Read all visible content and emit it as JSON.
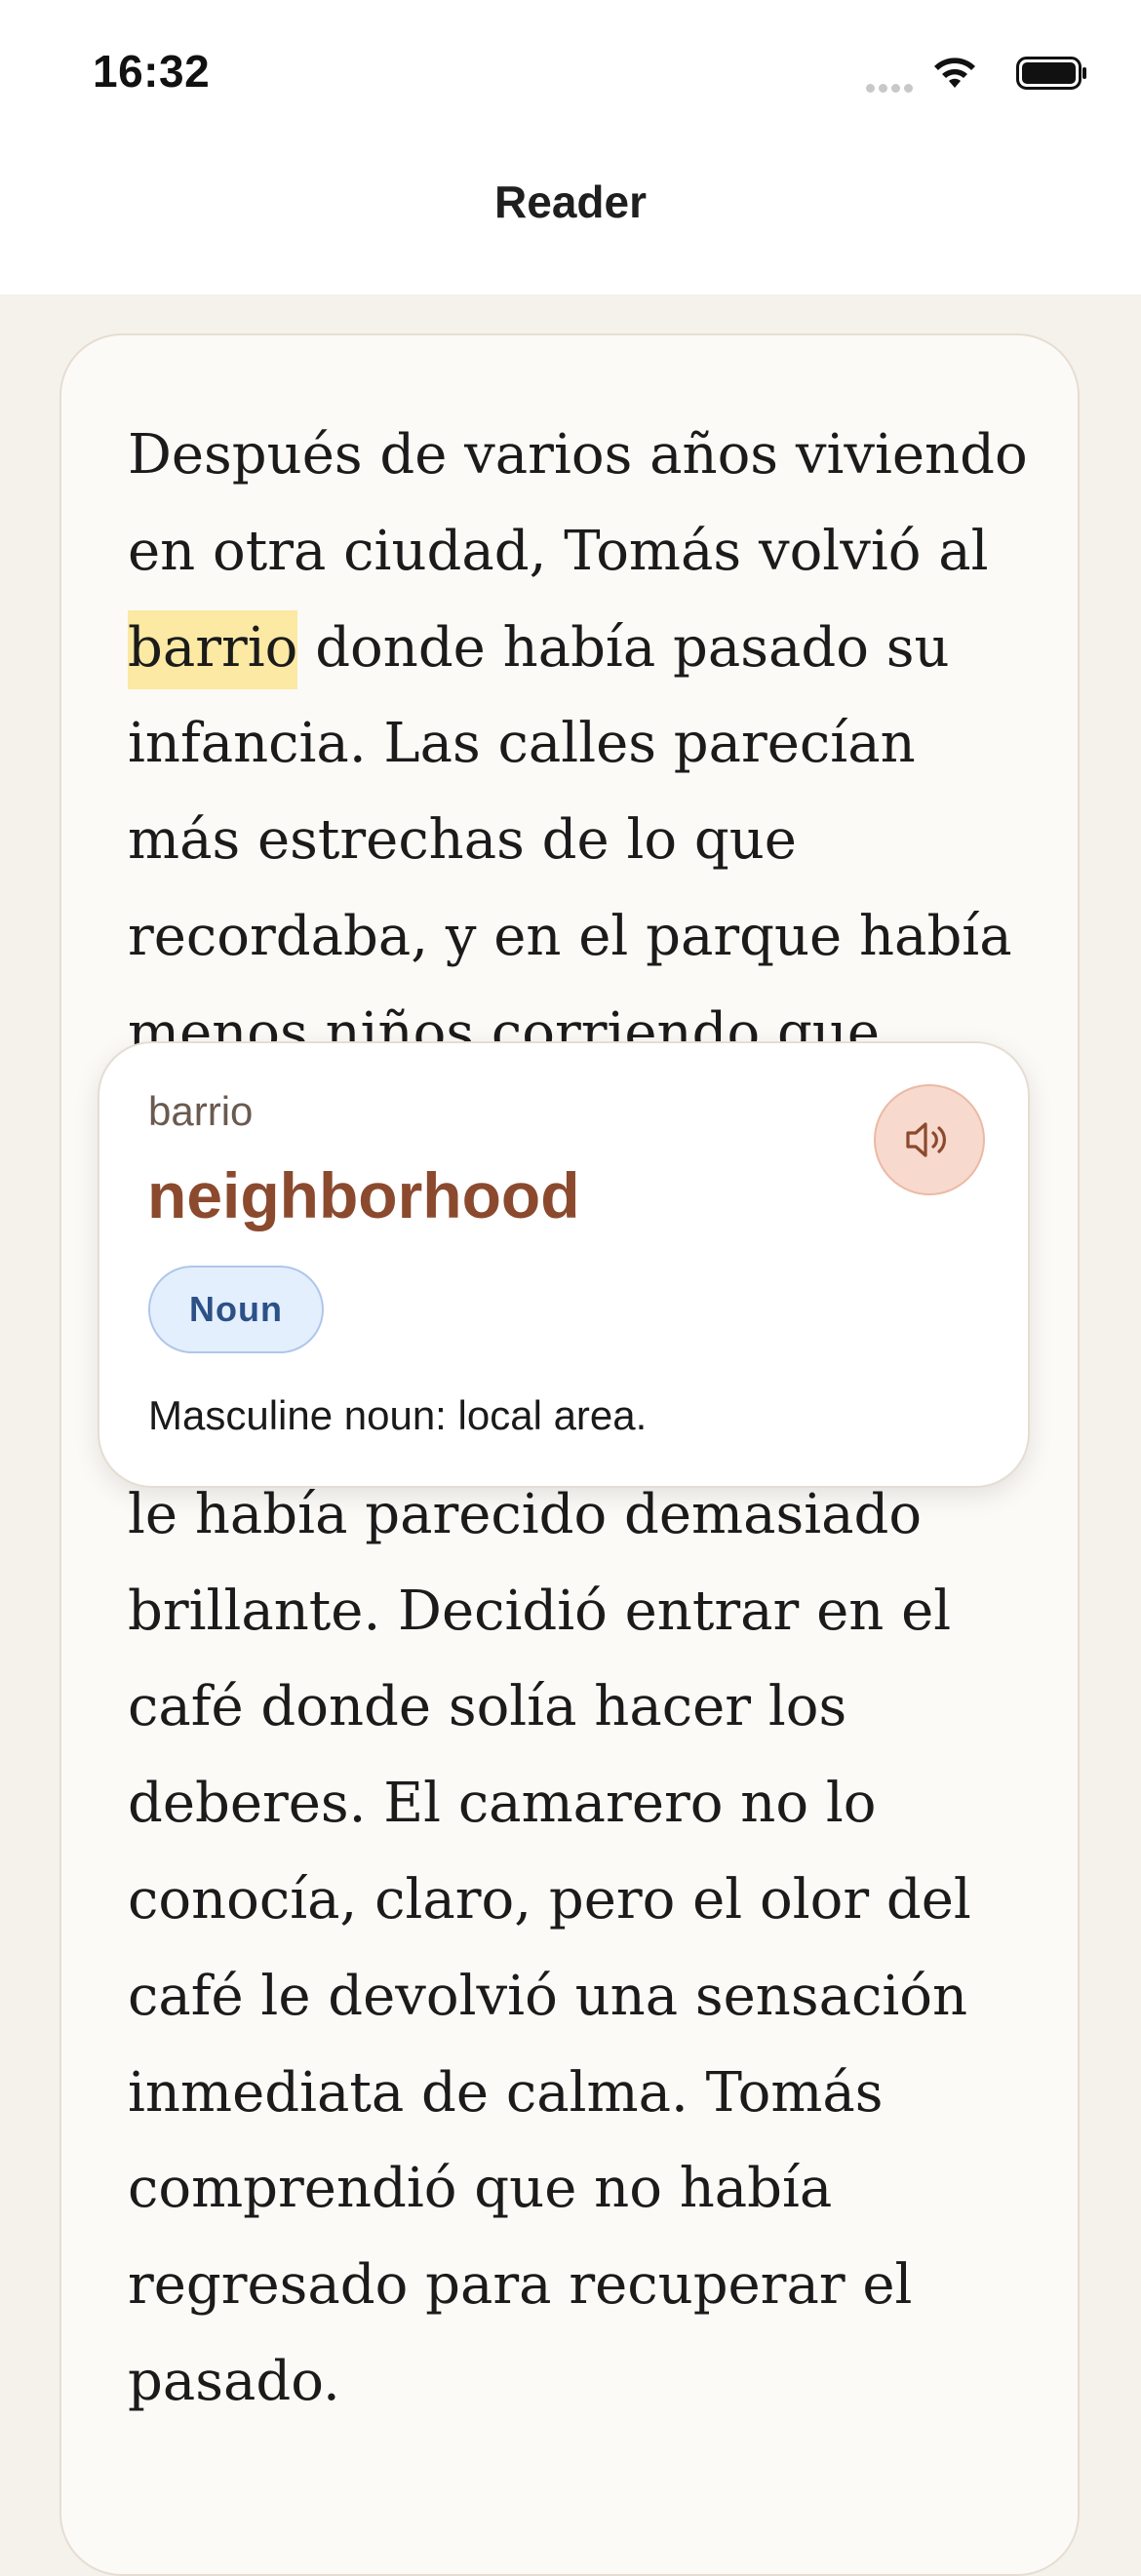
{
  "status_bar": {
    "time": "16:32"
  },
  "nav": {
    "title": "Reader"
  },
  "reader": {
    "text_before_highlight": "Después de varios años viviendo en otra ciudad, Tomás volvió al ",
    "highlighted_word": "barrio",
    "text_after_highlight": " donde había pasado su infancia. Las calles parecían más estrechas de lo que recordaba, y en el parque había menos niños corriendo que antes. Mientras caminaba por la avenida principal, reconoció el balcón de doña Marta y el color azul de una puerta que siempre le había parecido demasiado brillante. Decidió entrar en el café donde solía hacer los deberes. El camarero no lo conocía, claro, pero el olor del café le devolvió una sensación inmediata de calma. Tomás comprendió que no había regresado para recuperar el pasado."
  },
  "translation_popup": {
    "word": "barrio",
    "translation": "neighborhood",
    "part_of_speech": "Noun",
    "definition": "Masculine noun: local area.",
    "speaker_icon": "speaker-icon"
  },
  "colors": {
    "highlight": "#fbe9a4",
    "accent_brown": "#8b4a2e",
    "badge_blue": "#2c5088",
    "speaker_bg": "#f8d9cd"
  }
}
